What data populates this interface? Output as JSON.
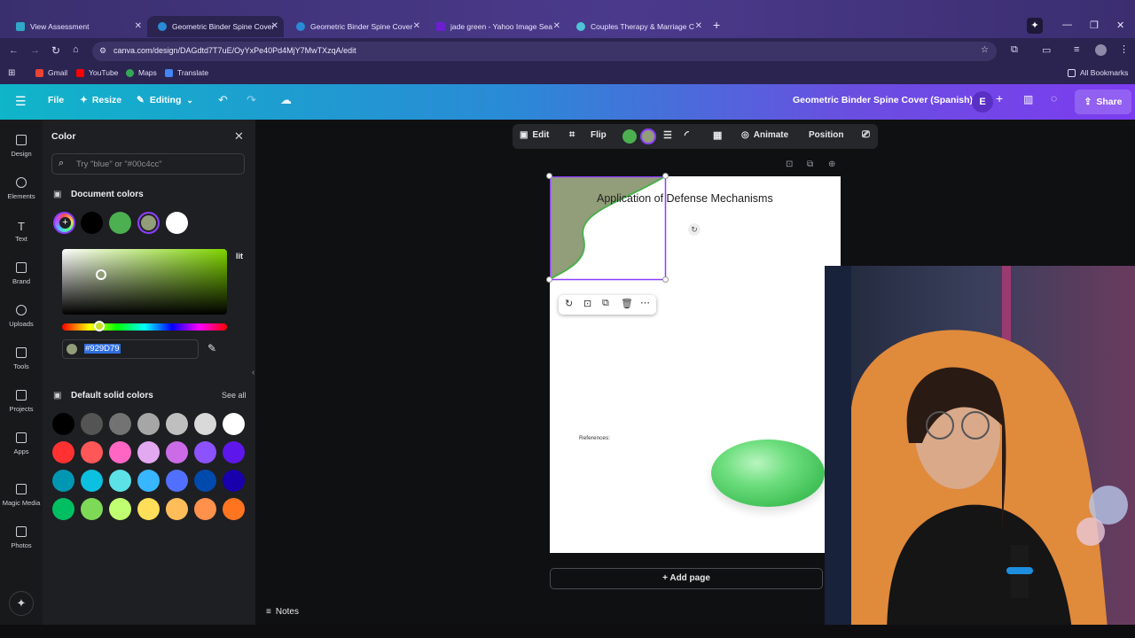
{
  "browser": {
    "tabs": [
      {
        "label": "View Assessment"
      },
      {
        "label": "Geometric Binder Spine Cover"
      },
      {
        "label": "Geometric Binder Spine Cover"
      },
      {
        "label": "jade green - Yahoo Image Sea"
      },
      {
        "label": "Couples Therapy & Marriage C"
      }
    ],
    "url": "canva.com/design/DAGdtd7T7uE/OyYxPe40Pd4MjY7MwTXzqA/edit",
    "bookmarks": [
      "Gmail",
      "YouTube",
      "Maps",
      "Translate"
    ],
    "all_bookmarks": "All Bookmarks"
  },
  "canva": {
    "file": "File",
    "resize": "Resize",
    "editing": "Editing",
    "doc_title": "Geometric Binder Spine Cover (Spanish)",
    "avatar_initial": "E",
    "share": "Share"
  },
  "rail": [
    {
      "label": "Design",
      "icon": "design-icon"
    },
    {
      "label": "Elements",
      "icon": "elements-icon"
    },
    {
      "label": "Text",
      "icon": "text-icon"
    },
    {
      "label": "Brand",
      "icon": "brand-icon"
    },
    {
      "label": "Uploads",
      "icon": "uploads-icon"
    },
    {
      "label": "Tools",
      "icon": "tools-icon"
    },
    {
      "label": "Projects",
      "icon": "projects-icon"
    },
    {
      "label": "Apps",
      "icon": "apps-icon"
    },
    {
      "label": "Magic Media",
      "icon": "magic-media-icon"
    },
    {
      "label": "Photos",
      "icon": "photos-icon"
    }
  ],
  "panel": {
    "title": "Color",
    "search_placeholder": "Try \"blue\" or \"#00c4cc\"",
    "document_colors": "Document colors",
    "document_swatches": [
      "#000000",
      "#4caf50",
      "#929D79",
      "#ffffff"
    ],
    "hex_value": "#929D79",
    "edit_fragment": "lit",
    "default_solid": "Default solid colors",
    "see_all": "See all",
    "default_swatches": [
      "#000000",
      "#545454",
      "#737373",
      "#a6a6a6",
      "#bfbfbf",
      "#d9d9d9",
      "#ffffff",
      "#ff3131",
      "#ff5757",
      "#ff66c4",
      "#e2a9f1",
      "#cb6ce6",
      "#8c52ff",
      "#5e17eb",
      "#0097b2",
      "#0cc0df",
      "#5ce1e6",
      "#38b6ff",
      "#5170ff",
      "#004aad",
      "#1800ad",
      "#00bf63",
      "#7ed957",
      "#c1ff72",
      "#ffde59",
      "#ffbd59",
      "#ff914d",
      "#ff751f"
    ]
  },
  "toolbar": {
    "edit": "Edit",
    "flip": "Flip",
    "animate": "Animate",
    "position": "Position",
    "color1": "#4caf50",
    "color2": "#929D79"
  },
  "page": {
    "heading": "Application of Defense Mechanisms",
    "references": "References:",
    "add_page": "+ Add page"
  },
  "notes": "Notes",
  "colors": {
    "accent": "#8b3dff",
    "sage": "#929D79",
    "jade": "#5dd370"
  }
}
